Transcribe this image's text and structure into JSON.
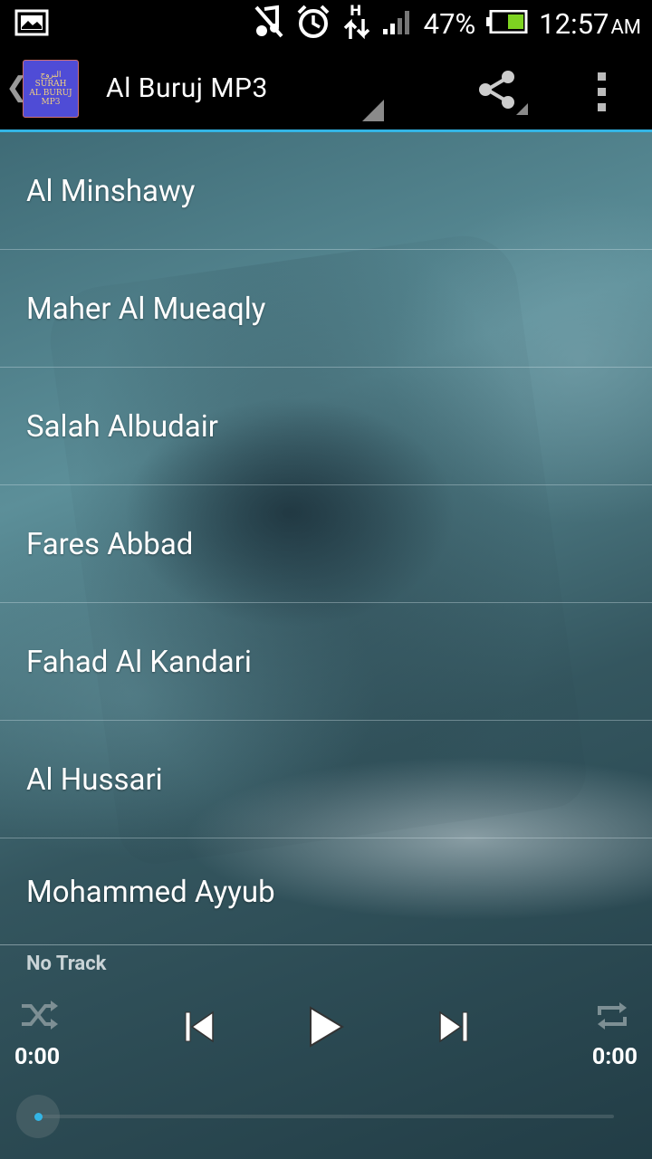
{
  "status_bar": {
    "battery_percent": "47%",
    "time": "12:57",
    "ampm": "AM",
    "icons": [
      "image-icon",
      "music-muted-icon",
      "alarm-icon",
      "hspa-data-icon",
      "signal-icon",
      "battery-icon"
    ]
  },
  "action_bar": {
    "title": "Al Buruj MP3",
    "app_icon_lines": [
      "البروج",
      "SURAH",
      "AL BURUJ",
      "MP3"
    ],
    "icons": [
      "back-chevron-icon",
      "share-icon",
      "overflow-menu-icon"
    ]
  },
  "reciters": [
    {
      "label": "Al Minshawy"
    },
    {
      "label": "Maher Al Mueaqly"
    },
    {
      "label": "Salah Albudair"
    },
    {
      "label": "Fares Abbad"
    },
    {
      "label": "Fahad Al Kandari"
    },
    {
      "label": "Al Hussari"
    },
    {
      "label": "Mohammed Ayyub"
    }
  ],
  "player": {
    "track": "No Track",
    "elapsed": "0:00",
    "duration": "0:00",
    "progress": 0,
    "icons": [
      "shuffle-icon",
      "previous-icon",
      "play-icon",
      "next-icon",
      "repeat-icon"
    ]
  },
  "colors": {
    "accent": "#33b5e5",
    "action_bar": "#000000",
    "app_icon_bg": "#4f4cd6",
    "battery": "#7ed321"
  }
}
